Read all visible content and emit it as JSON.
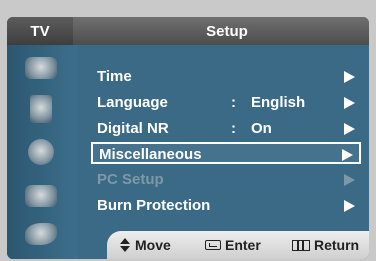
{
  "header": {
    "tab_label": "TV",
    "title": "Setup"
  },
  "menu": {
    "items": [
      {
        "label": "Time",
        "value": "",
        "state": "normal"
      },
      {
        "label": "Language",
        "value": "English",
        "state": "normal"
      },
      {
        "label": "Digital NR",
        "value": "On",
        "state": "normal"
      },
      {
        "label": "Miscellaneous",
        "value": "",
        "state": "selected"
      },
      {
        "label": "PC Setup",
        "value": "",
        "state": "disabled"
      },
      {
        "label": "Burn Protection",
        "value": "",
        "state": "normal"
      }
    ],
    "separator": ":"
  },
  "footer": {
    "move": "Move",
    "enter": "Enter",
    "return": "Return"
  },
  "colors": {
    "frame": "#3a6a86",
    "disabled": "#7f98a8",
    "footer": "#e0e0e0"
  },
  "icons": [
    "picture-icon",
    "sound-icon",
    "channel-icon",
    "setup-icon",
    "input-icon"
  ]
}
